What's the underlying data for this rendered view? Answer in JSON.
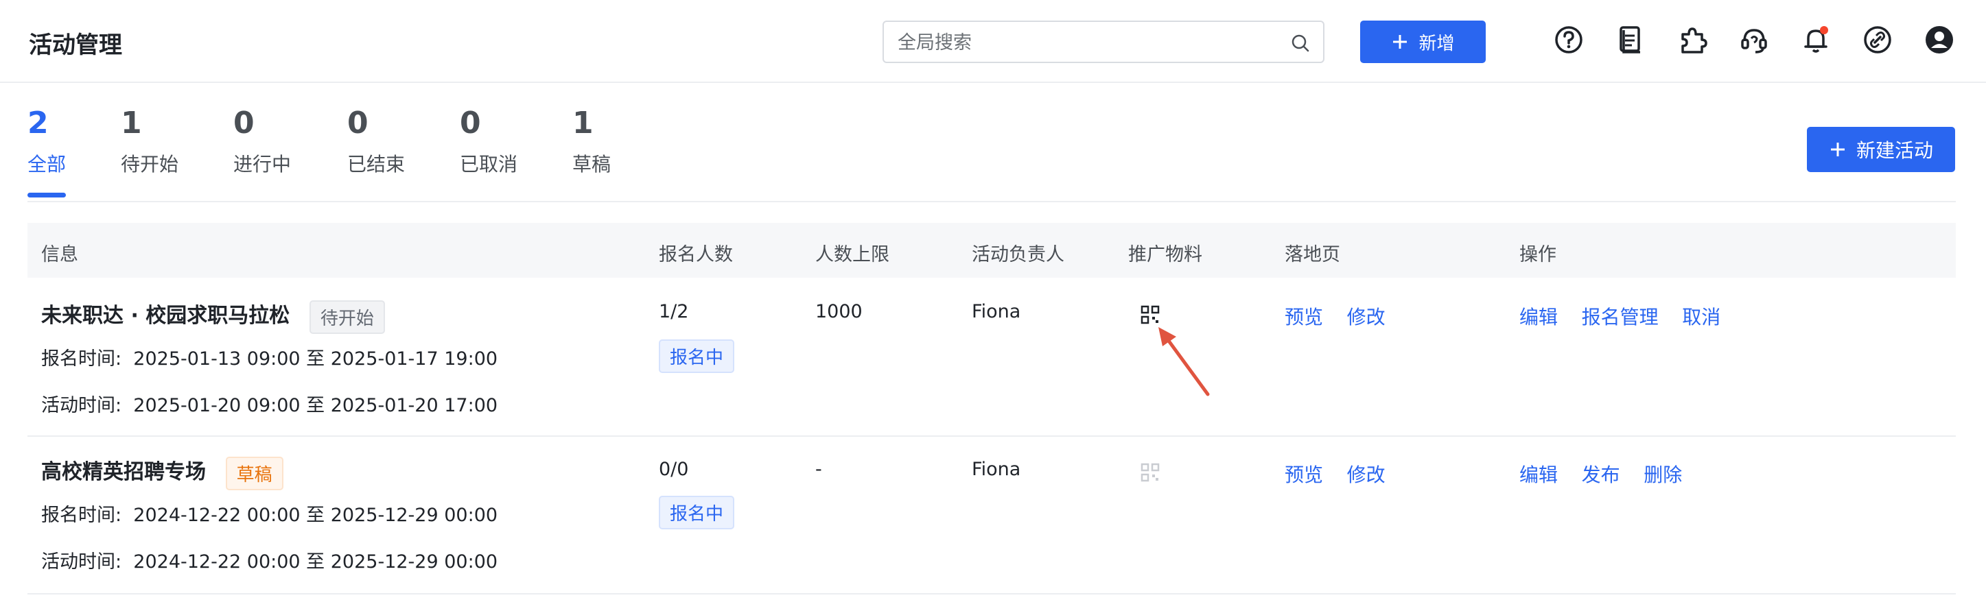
{
  "header": {
    "title": "活动管理",
    "search_placeholder": "全局搜索",
    "add_label": "新增",
    "icons": [
      "help-icon",
      "docs-icon",
      "plugin-icon",
      "support-icon",
      "notification-icon",
      "link-icon",
      "user-avatar-icon"
    ],
    "accent": "#2a66f0",
    "notification_dot_color": "#f5462d"
  },
  "tabs": [
    {
      "count": "2",
      "label": "全部",
      "active": true
    },
    {
      "count": "1",
      "label": "待开始"
    },
    {
      "count": "0",
      "label": "进行中"
    },
    {
      "count": "0",
      "label": "已结束"
    },
    {
      "count": "0",
      "label": "已取消"
    },
    {
      "count": "1",
      "label": "草稿"
    }
  ],
  "new_activity_label": "新建活动",
  "columns": [
    "信息",
    "报名人数",
    "人数上限",
    "活动负责人",
    "推广物料",
    "落地页",
    "操作"
  ],
  "rows": [
    {
      "title": "未来职达 · 校园求职马拉松",
      "status_tag": "待开始",
      "signup_label": "报名时间:",
      "signup_time": "2025-01-13 09:00 至 2025-01-17 19:00",
      "event_label": "活动时间:",
      "event_time": "2025-01-20 09:00 至 2025-01-20 17:00",
      "registrations": "1/2",
      "registration_status": "报名中",
      "limit": "1000",
      "owner": "Fiona",
      "promo_icon": "qr-code-icon",
      "landing_links": [
        "预览",
        "修改"
      ],
      "actions": [
        "编辑",
        "报名管理",
        "取消"
      ]
    },
    {
      "title": "高校精英招聘专场",
      "status_tag": "草稿",
      "signup_label": "报名时间:",
      "signup_time": "2024-12-22 00:00 至 2025-12-29 00:00",
      "event_label": "活动时间:",
      "event_time": "2024-12-22 00:00 至 2025-12-29 00:00",
      "registrations": "0/0",
      "registration_status": "报名中",
      "limit": "-",
      "owner": "Fiona",
      "promo_icon": "qr-code-disabled-icon",
      "landing_links": [
        "预览",
        "修改"
      ],
      "actions": [
        "编辑",
        "发布",
        "删除"
      ]
    }
  ]
}
